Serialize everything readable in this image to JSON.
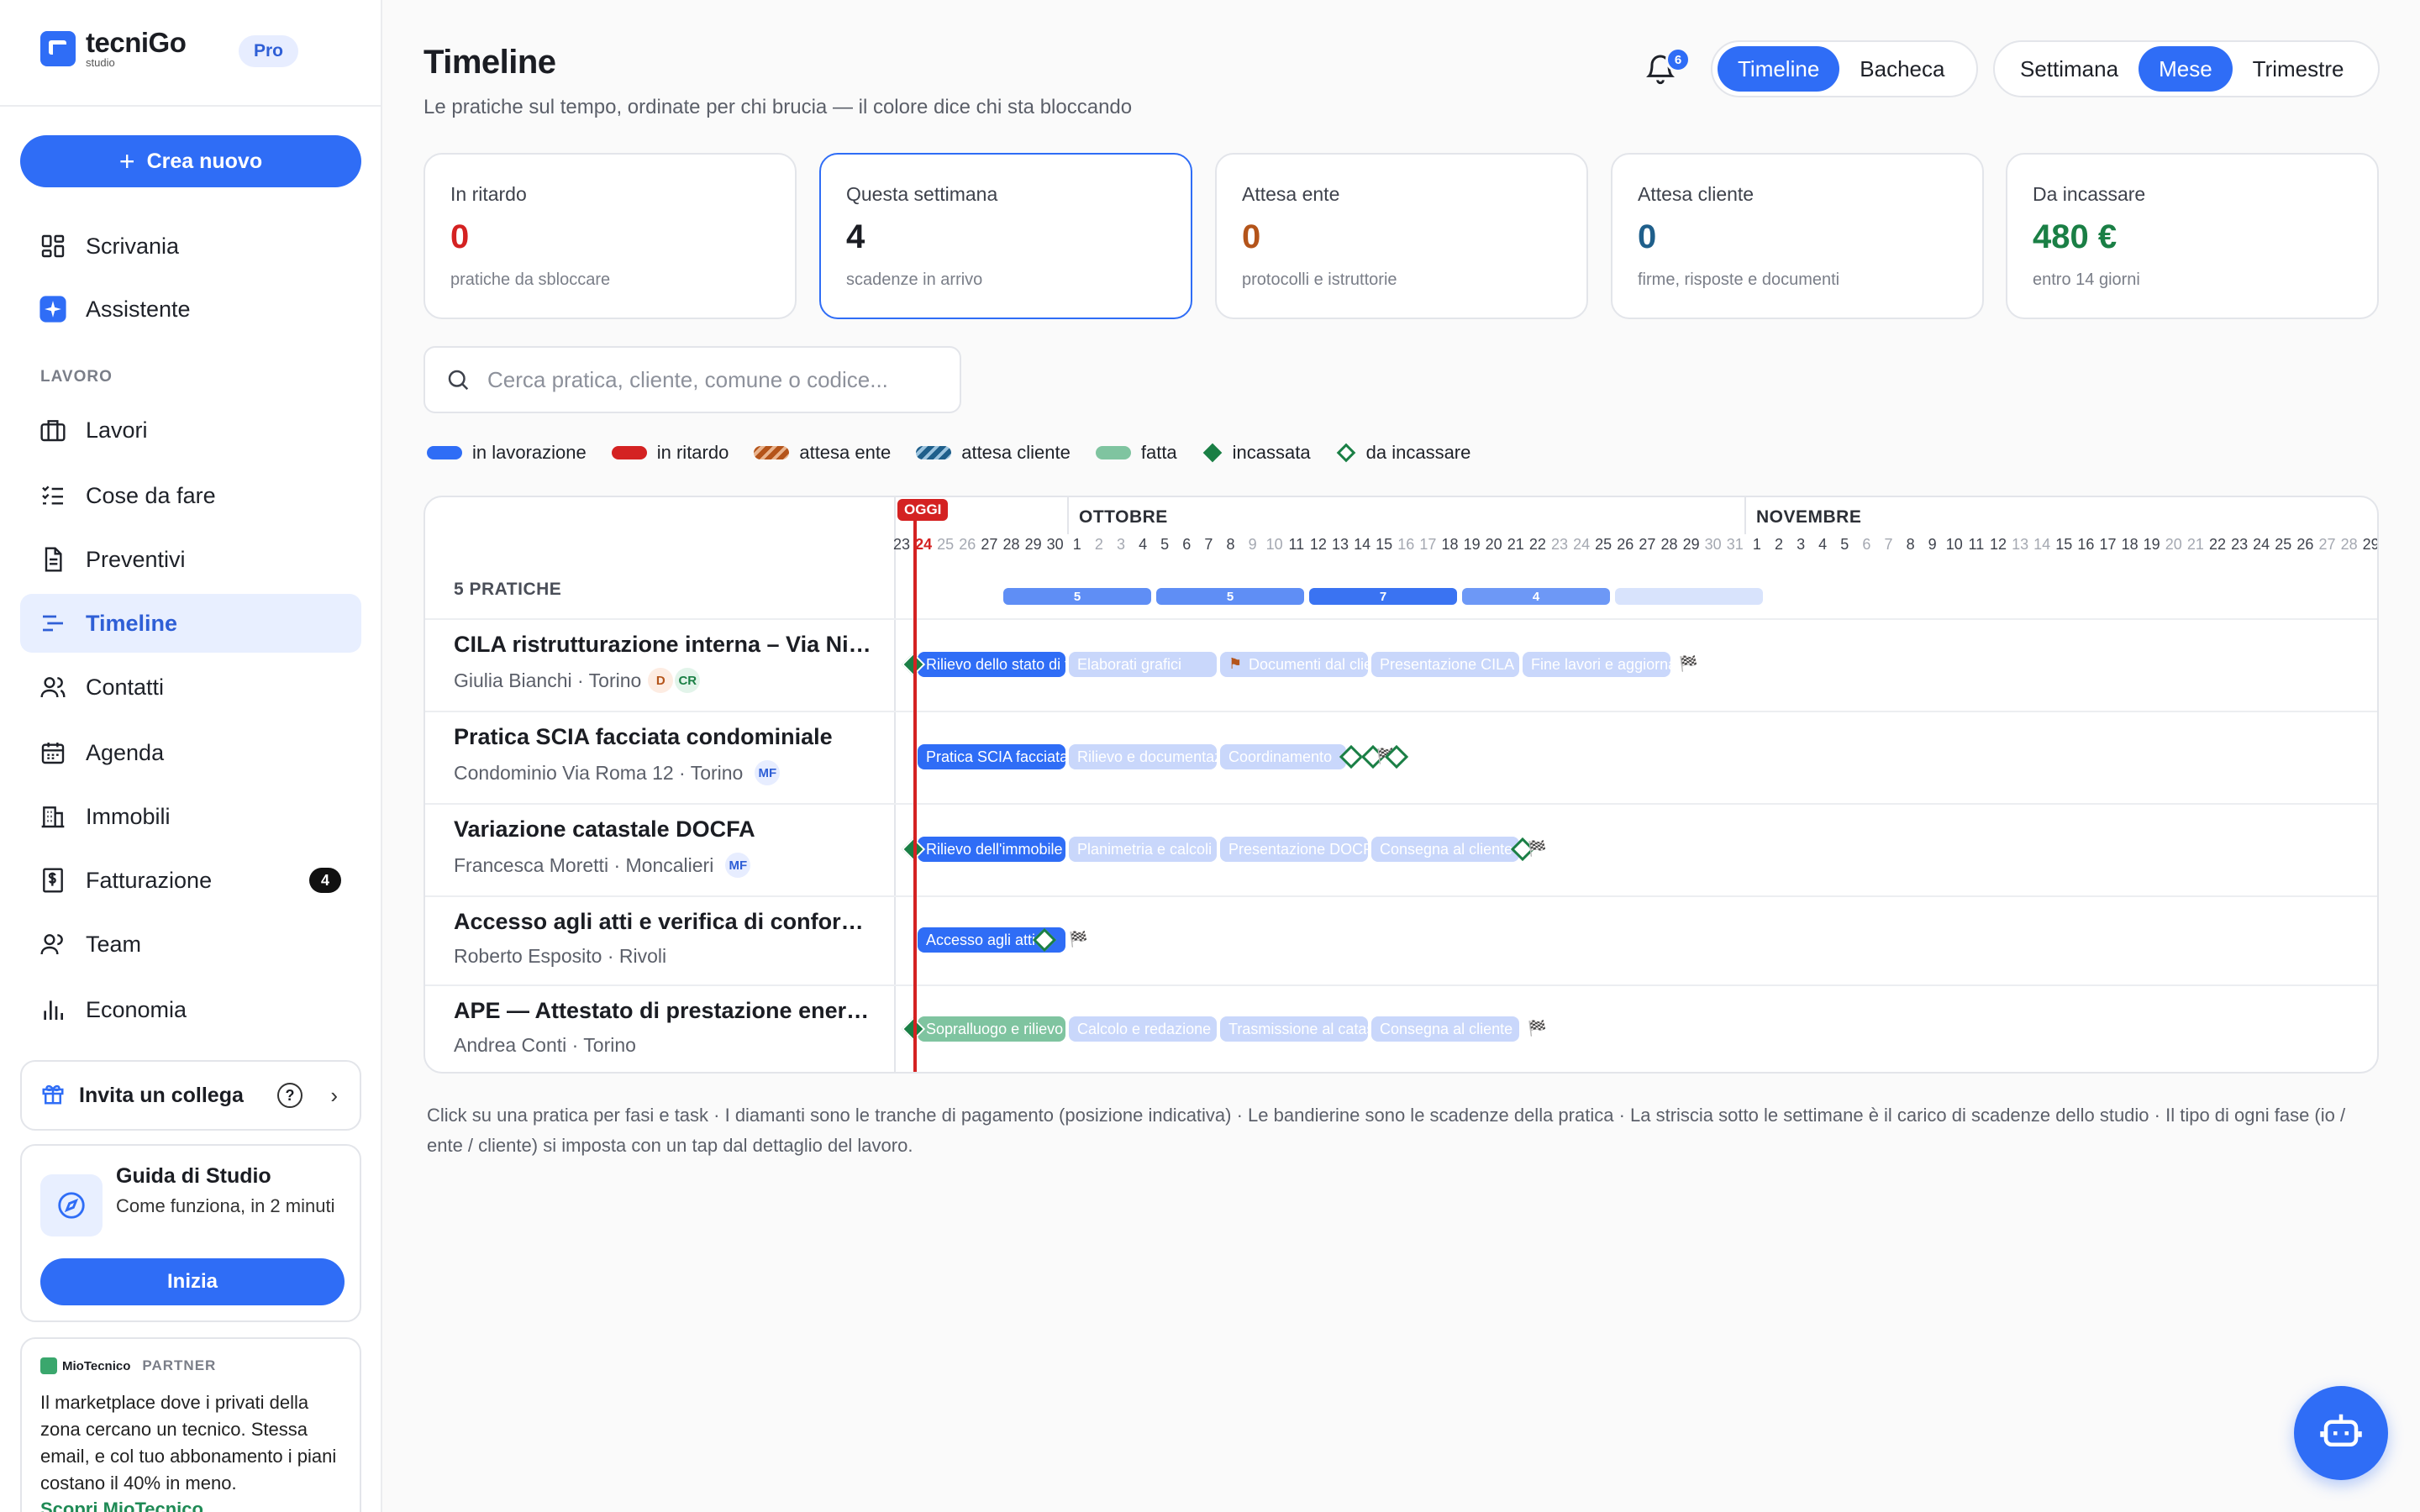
{
  "app": {
    "name": "tecniGo",
    "sub": "studio",
    "plan": "Pro"
  },
  "sidebar": {
    "create_label": "Crea nuovo",
    "section_label": "LAVORO",
    "items": [
      {
        "label": "Scrivania"
      },
      {
        "label": "Assistente"
      },
      {
        "label": "Lavori"
      },
      {
        "label": "Cose da fare"
      },
      {
        "label": "Preventivi"
      },
      {
        "label": "Timeline"
      },
      {
        "label": "Contatti"
      },
      {
        "label": "Agenda"
      },
      {
        "label": "Immobili"
      },
      {
        "label": "Fatturazione",
        "count": "4"
      },
      {
        "label": "Team"
      },
      {
        "label": "Economia"
      }
    ],
    "invite_label": "Invita un collega",
    "guide": {
      "title": "Guida di Studio",
      "text": "Come funziona, in 2 minuti",
      "button": "Inizia"
    },
    "partner": {
      "brand": "MioTecnico",
      "tag": "PARTNER",
      "text": "Il marketplace dove i privati della zona cercano un tecnico. Stessa email, e col tuo abbonamento i piani costano il 40% in meno.",
      "link": "Scopri MioTecnico"
    }
  },
  "header": {
    "title": "Timeline",
    "subtitle": "Le pratiche sul tempo, ordinate per chi brucia — il colore dice chi sta bloccando",
    "notifications": "6",
    "view_options": [
      "Timeline",
      "Bacheca"
    ],
    "view_selected": "Timeline",
    "range_options": [
      "Settimana",
      "Mese",
      "Trimestre"
    ],
    "range_selected": "Mese"
  },
  "cards": [
    {
      "label": "In ritardo",
      "value": "0",
      "sub": "pratiche da sbloccare",
      "color": "#d42222"
    },
    {
      "label": "Questa settimana",
      "value": "4",
      "sub": "scadenze in arrivo",
      "color": "#1b1d23"
    },
    {
      "label": "Attesa ente",
      "value": "0",
      "sub": "protocolli e istruttorie",
      "color": "#b4541a"
    },
    {
      "label": "Attesa cliente",
      "value": "0",
      "sub": "firme, risposte e documenti",
      "color": "#1f5f8b"
    },
    {
      "label": "Da incassare",
      "value": "480 €",
      "sub": "entro 14 giorni",
      "color": "#1a7f45"
    }
  ],
  "search": {
    "placeholder": "Cerca pratica, cliente, comune o codice..."
  },
  "legend": [
    {
      "label": "in lavorazione",
      "kind": "bar",
      "color": "#2f6df6"
    },
    {
      "label": "in ritardo",
      "kind": "bar",
      "color": "#d42222"
    },
    {
      "label": "attesa ente",
      "kind": "stripe",
      "color": "#b4541a"
    },
    {
      "label": "attesa cliente",
      "kind": "stripe",
      "color": "#1f5f8b"
    },
    {
      "label": "fatta",
      "kind": "bar",
      "color": "#7fc4a0"
    },
    {
      "label": "incassata",
      "kind": "diamond",
      "color": "#1a7f45"
    },
    {
      "label": "da incassare",
      "kind": "diamond-outline",
      "color": "#1a7f45"
    }
  ],
  "timeline": {
    "count_label": "5 PRATICHE",
    "today_label": "OGGI",
    "months": [
      "OTTOBRE",
      "NOVEMBRE"
    ],
    "days": [
      "23",
      "24",
      "25",
      "26",
      "27",
      "28",
      "29",
      "30",
      "1",
      "2",
      "3",
      "4",
      "5",
      "6",
      "7",
      "8",
      "9",
      "10",
      "11",
      "12",
      "13",
      "14",
      "15",
      "16",
      "17",
      "18",
      "19",
      "20",
      "21",
      "22",
      "23",
      "24",
      "25",
      "26",
      "27",
      "28",
      "29",
      "30",
      "31",
      "1",
      "2",
      "3",
      "4",
      "5",
      "6",
      "7",
      "8",
      "9",
      "10",
      "11",
      "12",
      "13",
      "14",
      "15",
      "16",
      "17",
      "18",
      "19",
      "20",
      "21",
      "22",
      "23",
      "24",
      "25",
      "26",
      "27",
      "28",
      "29"
    ],
    "load": [
      "5",
      "5",
      "7",
      "4",
      ""
    ],
    "practices": [
      {
        "title": "CILA ristrutturazione interna – Via Nizza",
        "client": "Giulia Bianchi · Torino",
        "avatars": [
          {
            "text": "D",
            "color": "#b4541a",
            "bg": "#fdece2"
          },
          {
            "text": "CR",
            "color": "#1a7f45",
            "bg": "#e2f4ea"
          }
        ],
        "phases": [
          "Rilievo dello stato di fatto",
          "Elaborati grafici",
          "Documenti dal cliente",
          "Presentazione CILA",
          "Fine lavori e aggiornamento"
        ]
      },
      {
        "title": "Pratica SCIA facciata condominiale",
        "client": "Condominio Via Roma 12 · Torino",
        "avatars": [
          {
            "text": "MF",
            "color": "#2f5fd6",
            "bg": "#e7edff"
          }
        ],
        "phases": [
          "Pratica SCIA facciata",
          "Rilievo e documentazione",
          "Coordinamento"
        ]
      },
      {
        "title": "Variazione catastale DOCFA",
        "client": "Francesca Moretti · Moncalieri",
        "avatars": [
          {
            "text": "MF",
            "color": "#2f5fd6",
            "bg": "#e7edff"
          }
        ],
        "phases": [
          "Rilievo dell'immobile",
          "Planimetria e calcoli",
          "Presentazione DOCFA",
          "Consegna al cliente"
        ]
      },
      {
        "title": "Accesso agli atti e verifica di conformità",
        "client": "Roberto Esposito · Rivoli",
        "avatars": [],
        "phases": [
          "Accesso agli atti"
        ]
      },
      {
        "title": "APE — Attestato di prestazione energetica",
        "client": "Andrea Conti · Torino",
        "avatars": [],
        "phases": [
          "Sopralluogo e rilievo",
          "Calcolo e redazione",
          "Trasmissione al catasto",
          "Consegna al cliente"
        ]
      }
    ]
  },
  "footnote": "Click su una pratica per fasi e task · I diamanti sono le tranche di pagamento (posizione indicativa) · Le bandierine sono le scadenze della pratica · La striscia sotto le settimane è il carico di scadenze dello studio · Il tipo di ogni fase (io / ente / cliente) si imposta con un tap dal dettaglio del lavoro.",
  "assistant_icon": "robot-icon"
}
